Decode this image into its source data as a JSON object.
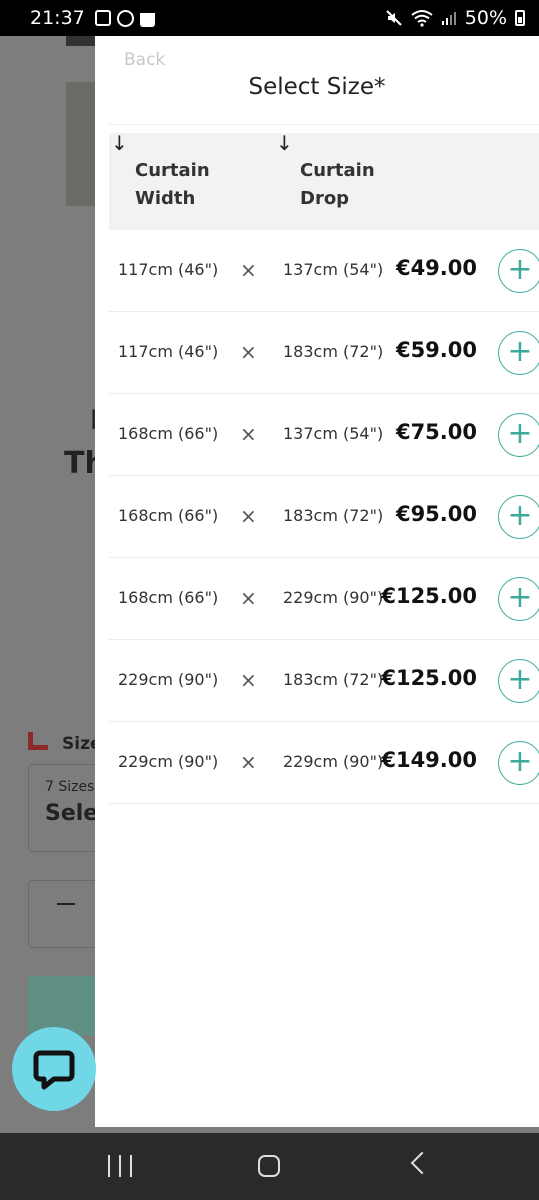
{
  "status_bar": {
    "time": "21:37",
    "battery": "50%"
  },
  "background": {
    "heading_fragment_1": "l",
    "heading_fragment_2": "Th",
    "size_label": "Size",
    "select_count": "7 Sizes",
    "select_value": "Selec"
  },
  "drawer": {
    "back_label": "Back",
    "title": "Select Size*",
    "headers": {
      "width_line1": "Curtain",
      "width_line2": "Width",
      "drop_line1": "Curtain",
      "drop_line2": "Drop"
    },
    "separator": "×",
    "rows": [
      {
        "width": "117cm (46\")",
        "drop": "137cm (54\")",
        "price": "€49.00"
      },
      {
        "width": "117cm (46\")",
        "drop": "183cm (72\")",
        "price": "€59.00"
      },
      {
        "width": "168cm (66\")",
        "drop": "137cm (54\")",
        "price": "€75.00"
      },
      {
        "width": "168cm (66\")",
        "drop": "183cm (72\")",
        "price": "€95.00"
      },
      {
        "width": "168cm (66\")",
        "drop": "229cm (90\")",
        "price": "€125.00"
      },
      {
        "width": "229cm (90\")",
        "drop": "183cm (72\")",
        "price": "€125.00"
      },
      {
        "width": "229cm (90\")",
        "drop": "229cm (90\")",
        "price": "€149.00"
      }
    ],
    "add_symbol": "+"
  },
  "colors": {
    "accent": "#3aaa9a",
    "chat_bubble": "#6fd7e6"
  }
}
